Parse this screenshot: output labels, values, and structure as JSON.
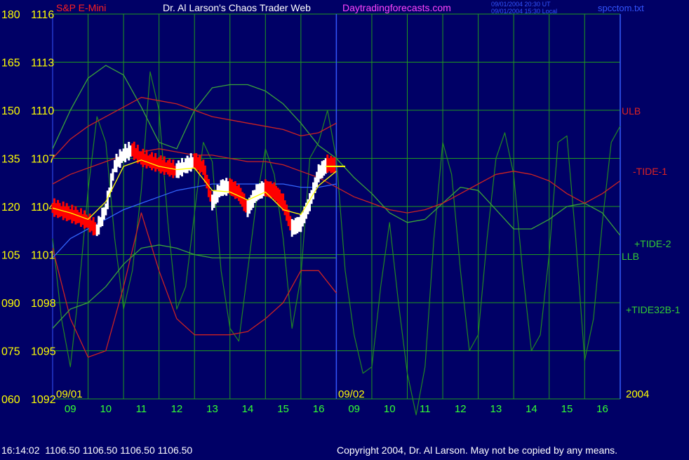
{
  "header": {
    "instrument": "S&P E-Mini",
    "title": "Dr. Al Larson's Chaos Trader Web",
    "site": "Daytradingforecasts.com",
    "stamp_ut": "09/01/2004 20:30 UT",
    "stamp_local": "09/01/2004 15:30 Local",
    "file": "spcctom.txt"
  },
  "footer": {
    "quote": "16:14:02  1106.50 1106.50 1106.50 1106.50",
    "copyright": "Copyright 2004, Dr. Al Larson. May not be copied by any means."
  },
  "colors": {
    "background": "#000066",
    "grid": "#1f9a1f",
    "price_bar": "#ffffff",
    "down_bar": "#ff0000",
    "avg": "#ffff00",
    "tide": "#228822",
    "band": "#cc2222",
    "bottom_band": "#3aa33a",
    "llb": "#3366ff"
  },
  "chart_data": {
    "type": "line",
    "left_axis_labels": [
      "180",
      "165",
      "150",
      "135",
      "120",
      "105",
      "090",
      "075",
      "060"
    ],
    "right_price_labels": [
      "1116",
      "1113",
      "1110",
      "1107",
      "1104",
      "1101",
      "1098",
      "1095",
      "1092"
    ],
    "left_axis_range": [
      60,
      180
    ],
    "price_range": [
      1092,
      1116
    ],
    "date_labels": [
      "09/01",
      "09/02"
    ],
    "year_label": "2004",
    "x_hour_labels": [
      "09",
      "10",
      "11",
      "12",
      "13",
      "14",
      "15",
      "16",
      "09",
      "10",
      "11",
      "12",
      "13",
      "14",
      "15",
      "16"
    ],
    "x_range_hours": [
      0,
      16
    ],
    "x_note": "x is hours after 09/01 08:30; 09/02 session starts at x=8",
    "series_labels": [
      "ULB",
      "-TIDE-1",
      "+TIDE-2",
      "LLB",
      "+TIDE32B-1"
    ],
    "price": {
      "x": [
        0,
        0.25,
        0.5,
        0.75,
        1.0,
        1.25,
        1.5,
        1.75,
        2.0,
        2.25,
        2.5,
        2.75,
        3.0,
        3.25,
        3.5,
        3.75,
        4.0,
        4.25,
        4.5,
        4.75,
        5.0,
        5.25,
        5.5,
        5.75,
        6.0,
        6.25,
        6.5,
        6.75,
        7.0,
        7.25,
        7.5,
        7.75,
        8.0
      ],
      "values": [
        1103.9,
        1103.7,
        1103.5,
        1103.3,
        1103.0,
        1102.5,
        1103.8,
        1106.5,
        1107.2,
        1107.5,
        1107.0,
        1106.8,
        1106.6,
        1106.4,
        1106.2,
        1106.5,
        1106.8,
        1106.4,
        1104.2,
        1105.1,
        1105.2,
        1104.8,
        1103.8,
        1104.8,
        1105.1,
        1104.9,
        1104.2,
        1102.6,
        1102.9,
        1104.2,
        1106.0,
        1106.6,
        1106.5
      ]
    },
    "avg_line": {
      "x": [
        0,
        0.5,
        1.0,
        1.5,
        2.0,
        2.5,
        3.0,
        3.5,
        4.0,
        4.5,
        5.0,
        5.5,
        6.0,
        6.5,
        7.0,
        7.5,
        8.0
      ],
      "values": [
        1103.9,
        1103.6,
        1103.2,
        1104.3,
        1106.5,
        1106.9,
        1106.5,
        1106.3,
        1106.4,
        1105.0,
        1104.9,
        1104.4,
        1104.9,
        1103.8,
        1103.5,
        1105.3,
        1106.2
      ]
    },
    "ulb": {
      "x": [
        0,
        0.5,
        1.0,
        1.5,
        2.0,
        2.5,
        3.0,
        3.5,
        4.0,
        4.5,
        5.0,
        5.5,
        6.0,
        6.5,
        7.0,
        7.5,
        8.0
      ],
      "values": [
        135,
        141,
        145,
        148,
        151,
        154,
        153,
        152,
        150,
        148,
        147,
        146,
        145,
        144,
        142,
        143,
        146
      ]
    },
    "llb": {
      "x": [
        0,
        0.5,
        1.0,
        1.5,
        2.0,
        2.5,
        3.0,
        3.5,
        4.0,
        4.5,
        5.0,
        5.5,
        6.0,
        6.5,
        7.0,
        7.5,
        8.0
      ],
      "values": [
        104,
        110,
        113,
        116,
        119,
        121,
        123,
        125,
        126,
        127,
        127,
        127,
        127,
        127,
        126,
        126,
        127
      ]
    },
    "tide_minus_1": {
      "x": [
        0,
        0.5,
        1.0,
        1.5,
        2.0,
        2.5,
        3.0,
        3.5,
        4.0,
        4.5,
        5.0,
        5.5,
        6.0,
        6.5,
        7.0,
        7.5,
        8.0,
        8.5,
        9.0,
        9.5,
        10.0,
        10.5,
        11.0,
        11.5,
        12.0,
        12.5,
        13.0,
        13.5,
        14.0,
        14.5,
        15.0,
        15.5,
        16.0
      ],
      "values": [
        127,
        130,
        132,
        134,
        136,
        137,
        138,
        137,
        136,
        136,
        135,
        134,
        134,
        133,
        131,
        129,
        126,
        123,
        121,
        119,
        118,
        119,
        121,
        124,
        127,
        130,
        131,
        130,
        128,
        124,
        121,
        124,
        128
      ]
    },
    "tide_plus_2": {
      "x": [
        0,
        0.5,
        1.0,
        1.5,
        2.0,
        2.5,
        3.0,
        3.5,
        4.0,
        4.5,
        5.0,
        5.5,
        6.0,
        6.5,
        7.0,
        7.5,
        8.0,
        8.5,
        9.0,
        9.5,
        10.0,
        10.5,
        11.0,
        11.5,
        12.0,
        12.5,
        13.0,
        13.5,
        14.0,
        14.5,
        15.0,
        15.5,
        16.0
      ],
      "values": [
        138,
        150,
        160,
        164,
        161,
        151,
        140,
        138,
        150,
        157,
        158,
        158,
        156,
        152,
        146,
        139,
        135,
        129,
        124,
        118,
        115,
        116,
        121,
        126,
        125,
        119,
        113,
        113,
        116,
        120,
        121,
        118,
        111
      ]
    },
    "tide32b_1": {
      "x": [
        0,
        0.25,
        0.5,
        0.75,
        1.0,
        1.25,
        1.5,
        1.75,
        2.0,
        2.25,
        2.5,
        2.75,
        3.0,
        3.25,
        3.5,
        3.75,
        4.0,
        4.25,
        4.5,
        4.75,
        5.0,
        5.25,
        5.5,
        5.75,
        6.0,
        6.25,
        6.5,
        6.75,
        7.0,
        7.25,
        7.5,
        7.75,
        8.0,
        8.25,
        8.5,
        8.75,
        9.0,
        9.25,
        9.5,
        9.75,
        10.0,
        10.25,
        10.5,
        10.75,
        11.0,
        11.25,
        11.5,
        11.75,
        12.0,
        12.25,
        12.5,
        12.75,
        13.0,
        13.25,
        13.5,
        13.75,
        14.0,
        14.25,
        14.5,
        14.75,
        15.0,
        15.25,
        15.5,
        15.75,
        16.0
      ],
      "values": [
        110,
        85,
        70,
        95,
        125,
        148,
        140,
        110,
        88,
        100,
        125,
        162,
        150,
        115,
        88,
        95,
        118,
        140,
        134,
        100,
        82,
        78,
        100,
        122,
        138,
        130,
        110,
        82,
        98,
        135,
        140,
        150,
        135,
        100,
        80,
        68,
        70,
        95,
        115,
        90,
        68,
        55,
        70,
        110,
        140,
        130,
        100,
        75,
        80,
        110,
        135,
        143,
        130,
        100,
        75,
        80,
        105,
        140,
        142,
        110,
        72,
        85,
        115,
        140,
        145
      ]
    },
    "bottom_band": {
      "x": [
        0,
        0.5,
        1.0,
        1.5,
        2.0,
        2.5,
        3.0,
        3.5,
        4.0,
        4.5,
        5.0,
        5.5,
        6.0,
        6.5,
        7.0,
        7.5,
        8.0
      ],
      "values": [
        82,
        88,
        90,
        95,
        102,
        107,
        108,
        107,
        105,
        104,
        104,
        104,
        104,
        104,
        104,
        104,
        104
      ]
    },
    "lower_red": {
      "x": [
        0,
        0.5,
        1.0,
        1.5,
        2.0,
        2.5,
        3.0,
        3.5,
        4.0,
        4.5,
        5.0,
        5.5,
        6.0,
        6.5,
        7.0,
        7.5,
        8.0
      ],
      "values": [
        107,
        85,
        73,
        75,
        95,
        118,
        100,
        85,
        80,
        80,
        80,
        81,
        85,
        90,
        100,
        100,
        93
      ]
    }
  }
}
